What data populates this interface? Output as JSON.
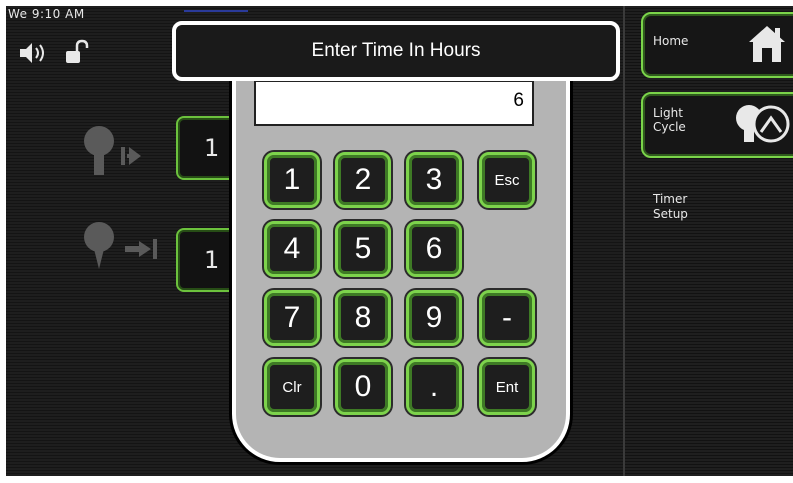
{
  "status": {
    "clock": "We 9:10 AM"
  },
  "dialog": {
    "title": "Enter Time In Hours",
    "display_value": "6"
  },
  "keypad": {
    "keys": [
      "1",
      "2",
      "3",
      "Esc",
      "4",
      "5",
      "6",
      "7",
      "8",
      "9",
      "-",
      "Clr",
      "0",
      ".",
      "Ent"
    ]
  },
  "background": {
    "field_1": "1",
    "field_2": "1"
  },
  "sidebar": {
    "home_label": "Home",
    "light_cycle_label_1": "Light",
    "light_cycle_label_2": "Cycle",
    "timer_setup_label_1": "Timer",
    "timer_setup_label_2": "Setup"
  },
  "colors": {
    "accent_green": "#7dd34c",
    "keypad_gray": "#b4b4b4"
  }
}
